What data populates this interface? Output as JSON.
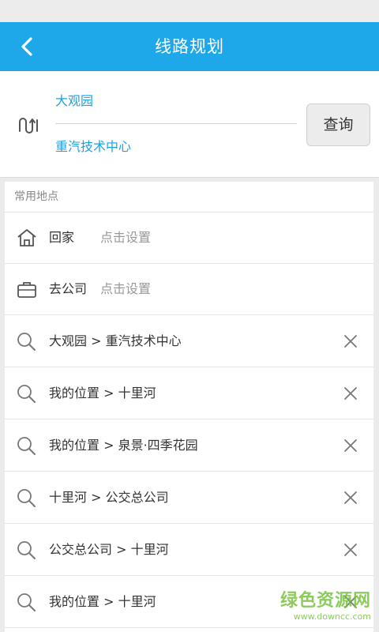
{
  "header": {
    "title": "线路规划",
    "back_icon": "chevron-left-icon"
  },
  "route": {
    "from": "大观园",
    "to": "重汽技术中心",
    "query_label": "查询",
    "swap_icon": "swap-route-icon"
  },
  "common_places": {
    "title": "常用地点",
    "items": [
      {
        "label": "回家",
        "hint": "点击设置",
        "icon": "home-icon"
      },
      {
        "label": "去公司",
        "hint": "点击设置",
        "icon": "briefcase-icon"
      }
    ]
  },
  "history": [
    {
      "text": "大观园 > 重汽技术中心"
    },
    {
      "text": "我的位置 > 十里河"
    },
    {
      "text": "我的位置 > 泉景·四季花园"
    },
    {
      "text": "十里河 > 公交总公司"
    },
    {
      "text": "公交总公司 > 十里河"
    },
    {
      "text": "我的位置 > 十里河"
    }
  ],
  "watermark": {
    "main": "绿色资源网",
    "sub": "www.downcc.com"
  },
  "colors": {
    "accent": "#1ea8ea",
    "route_text": "#1aa3e1",
    "watermark": "#7ac143"
  }
}
